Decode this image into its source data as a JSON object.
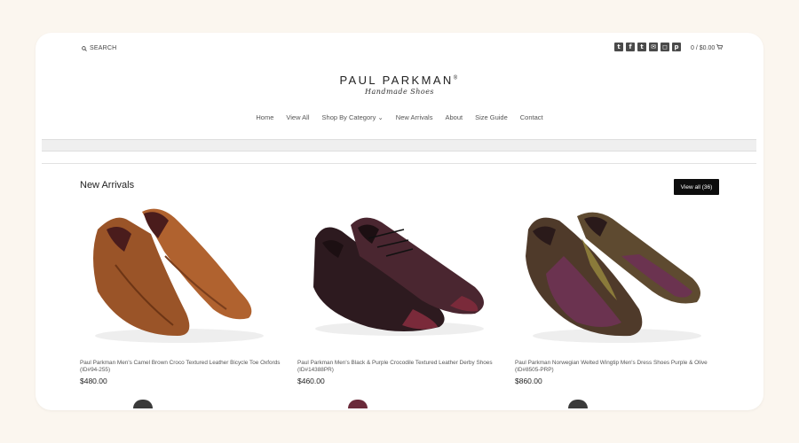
{
  "header": {
    "search_label": "SEARCH",
    "social": [
      {
        "icon": "twitter-icon",
        "glyph": "t"
      },
      {
        "icon": "facebook-icon",
        "glyph": "f"
      },
      {
        "icon": "tumblr-icon",
        "glyph": "t"
      },
      {
        "icon": "email-icon",
        "glyph": "✉"
      },
      {
        "icon": "instagram-icon",
        "glyph": "◻"
      },
      {
        "icon": "pinterest-icon",
        "glyph": "p"
      }
    ],
    "cart_label": "0 / $0.00"
  },
  "logo": {
    "main": "PAUL PARKMAN",
    "registered": "®",
    "sub": "Handmade Shoes"
  },
  "nav": {
    "items": [
      "Home",
      "View All",
      "Shop By Category",
      "New Arrivals",
      "About",
      "Size Guide",
      "Contact"
    ],
    "dropdown_indicator": "⌄"
  },
  "section": {
    "title": "New Arrivals",
    "view_all_label": "View all (36)"
  },
  "products": [
    {
      "name": "Paul Parkman Men's Camel Brown Croco Textured Leather Bicycle Toe Oxfords (ID#94-255)",
      "price": "$480.00",
      "color": "#8a4a22"
    },
    {
      "name": "Paul Parkman Men's Black & Purple Crocodile Textured Leather Derby Shoes (ID#14388PR)",
      "price": "$460.00",
      "color": "#3a1f24"
    },
    {
      "name": "Paul Parkman Norwegian Welted Wingtip Men's Dress Shoes Purple & Olive (ID#8505-PRP)",
      "price": "$860.00",
      "color": "#5a3a4a"
    }
  ],
  "colors": {
    "page_bg": "#fbf6ef",
    "card_bg": "#ffffff",
    "button_bg": "#0d0d0d"
  }
}
